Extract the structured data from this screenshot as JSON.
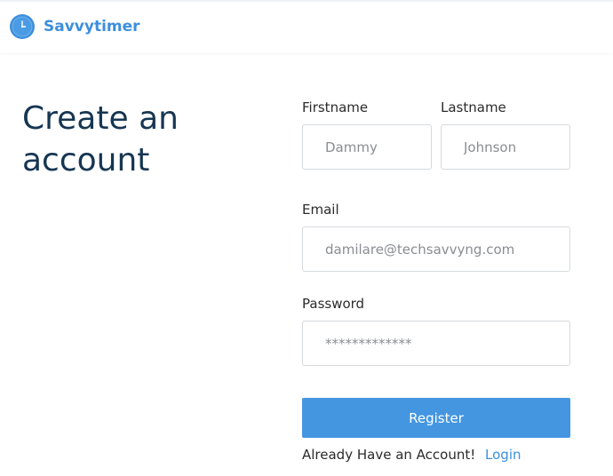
{
  "brand": {
    "name": "Savvytimer",
    "logo_icon": "clock-icon",
    "color": "#3d8fdc"
  },
  "page": {
    "heading": "Create an account"
  },
  "form": {
    "firstname": {
      "label": "Firstname",
      "placeholder": "Dammy"
    },
    "lastname": {
      "label": "Lastname",
      "placeholder": "Johnson"
    },
    "email": {
      "label": "Email",
      "placeholder": "damilare@techsavvyng.com"
    },
    "password": {
      "label": "Password",
      "placeholder": "*************"
    },
    "register_label": "Register",
    "register_color": "#4496e0"
  },
  "footer": {
    "prompt": "Already Have an Account!",
    "login_label": "Login"
  }
}
